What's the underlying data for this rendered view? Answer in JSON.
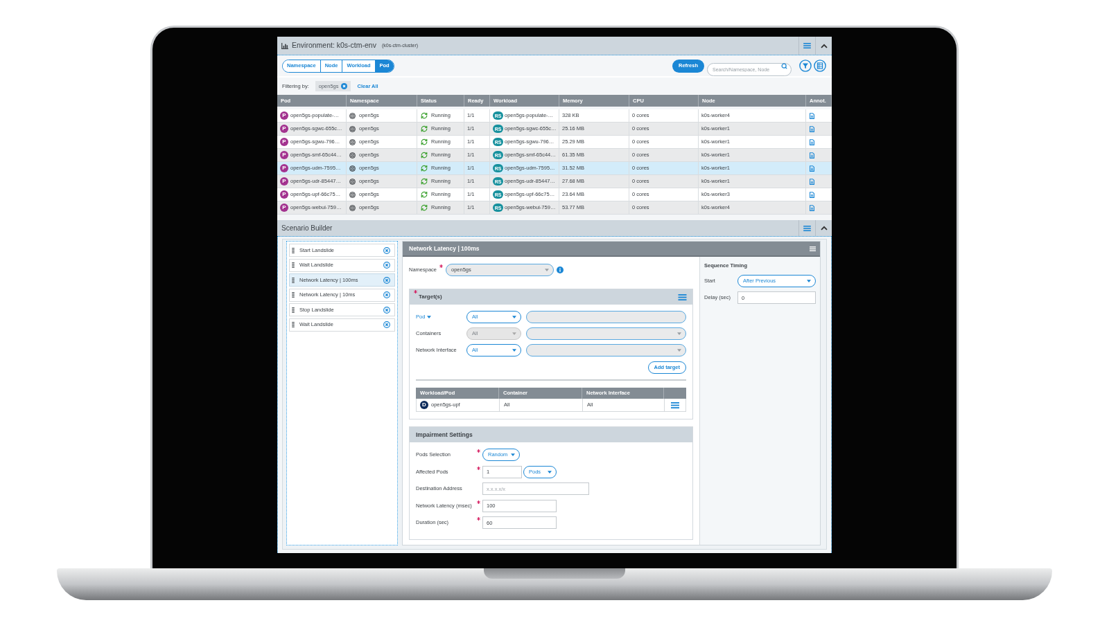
{
  "environment": {
    "title": "Environment: k0s-ctm-env",
    "subtitle": "(k0s-ctm-cluster)"
  },
  "view_tabs": [
    {
      "label": "Namespace",
      "selected": false
    },
    {
      "label": "Node",
      "selected": false
    },
    {
      "label": "Workload",
      "selected": false
    },
    {
      "label": "Pod",
      "selected": true
    }
  ],
  "refresh_button": "Refresh",
  "search": {
    "placeholder": "Search/Namespace, Node"
  },
  "filter": {
    "label": "Filtering by:",
    "chips": [
      "open5gs"
    ],
    "clear": "Clear All"
  },
  "pods_table": {
    "columns": [
      "Pod",
      "Namespace",
      "Status",
      "Ready",
      "Workload",
      "Memory",
      "CPU",
      "Node",
      "Annot."
    ],
    "rows": [
      {
        "selected": false,
        "pod_badge": "P",
        "pod": "open5gs-populate-…",
        "namespace": "open5gs",
        "status": "Running",
        "ready": "1/1",
        "workload_badge": "RS",
        "workload": "open5gs-populate-…",
        "memory": "328 KB",
        "cpu": "0 cores",
        "node": "k0s-worker4"
      },
      {
        "selected": false,
        "pod_badge": "P",
        "pod": "open5gs-sgwc-655c…",
        "namespace": "open5gs",
        "status": "Running",
        "ready": "1/1",
        "workload_badge": "RS",
        "workload": "open5gs-sgwc-655c…",
        "memory": "25.16 MB",
        "cpu": "0 cores",
        "node": "k0s-worker1"
      },
      {
        "selected": false,
        "pod_badge": "P",
        "pod": "open5gs-sgwu-796…",
        "namespace": "open5gs",
        "status": "Running",
        "ready": "1/1",
        "workload_badge": "RS",
        "workload": "open5gs-sgwu-796…",
        "memory": "25.29 MB",
        "cpu": "0 cores",
        "node": "k0s-worker1"
      },
      {
        "selected": false,
        "pod_badge": "P",
        "pod": "open5gs-smf-65c44…",
        "namespace": "open5gs",
        "status": "Running",
        "ready": "1/1",
        "workload_badge": "RS",
        "workload": "open5gs-smf-65c44…",
        "memory": "61.35 MB",
        "cpu": "0 cores",
        "node": "k0s-worker1"
      },
      {
        "selected": true,
        "pod_badge": "P",
        "pod": "open5gs-udm-7595…",
        "namespace": "open5gs",
        "status": "Running",
        "ready": "1/1",
        "workload_badge": "RS",
        "workload": "open5gs-udm-7595…",
        "memory": "31.52 MB",
        "cpu": "0 cores",
        "node": "k0s-worker1"
      },
      {
        "selected": false,
        "pod_badge": "P",
        "pod": "open5gs-udr-85447…",
        "namespace": "open5gs",
        "status": "Running",
        "ready": "1/1",
        "workload_badge": "RS",
        "workload": "open5gs-udr-85447…",
        "memory": "27.68 MB",
        "cpu": "0 cores",
        "node": "k0s-worker1"
      },
      {
        "selected": false,
        "pod_badge": "P",
        "pod": "open5gs-upf-66c75…",
        "namespace": "open5gs",
        "status": "Running",
        "ready": "1/1",
        "workload_badge": "RS",
        "workload": "open5gs-upf-66c75…",
        "memory": "23.64 MB",
        "cpu": "0 cores",
        "node": "k0s-worker3"
      },
      {
        "selected": false,
        "pod_badge": "P",
        "pod": "open5gs-webui-759…",
        "namespace": "open5gs",
        "status": "Running",
        "ready": "1/1",
        "workload_badge": "RS",
        "workload": "open5gs-webui-759…",
        "memory": "53.77 MB",
        "cpu": "0 cores",
        "node": "k0s-worker4"
      }
    ]
  },
  "scenario_builder": {
    "title": "Scenario Builder",
    "steps": [
      {
        "label": "Start Landslide",
        "selected": false
      },
      {
        "label": "Wait Landslide",
        "selected": false
      },
      {
        "label": "Network Latency | 100ms",
        "selected": true
      },
      {
        "label": "Network Latency | 10ms",
        "selected": false
      },
      {
        "label": "Stop Landslide",
        "selected": false
      },
      {
        "label": "Wait Landslide",
        "selected": false
      }
    ]
  },
  "step_editor": {
    "title": "Network Latency | 100ms",
    "namespace": {
      "label": "Namespace",
      "required": true,
      "value": "open5gs"
    },
    "targets": {
      "title": "Target(s)",
      "required": true,
      "fields": [
        {
          "kind": "filter",
          "label": "Pod",
          "value": "All",
          "disabled": false
        },
        {
          "kind": "select",
          "label": "Containers",
          "value": "All",
          "disabled": true
        },
        {
          "kind": "select",
          "label": "Network Interface",
          "value": "All",
          "disabled": false
        }
      ],
      "add_button": "Add target",
      "table": {
        "columns": [
          "Workload/Pod",
          "Container",
          "Network Interface"
        ],
        "rows": [
          {
            "badge": "D",
            "workload": "open5gs-upf",
            "container": "All",
            "interface": "All"
          }
        ]
      }
    },
    "impairment": {
      "title": "Impairment Settings",
      "fields": [
        {
          "kind": "select",
          "label": "Pods Selection",
          "required": true,
          "value": "Random"
        },
        {
          "kind": "count",
          "label": "Affected Pods",
          "required": true,
          "value": "1",
          "unit": "Pods"
        },
        {
          "kind": "text",
          "label": "Destination Address",
          "required": false,
          "placeholder": "x.x.x.x/x"
        },
        {
          "kind": "number",
          "label": "Network Latency (msec)",
          "required": true,
          "value": "100"
        },
        {
          "kind": "number",
          "label": "Duration (sec)",
          "required": true,
          "value": "60"
        }
      ]
    },
    "sequence_timing": {
      "title": "Sequence Timing",
      "start": {
        "label": "Start",
        "value": "After Previous"
      },
      "delay": {
        "label": "Delay (sec)",
        "value": "0"
      }
    }
  }
}
